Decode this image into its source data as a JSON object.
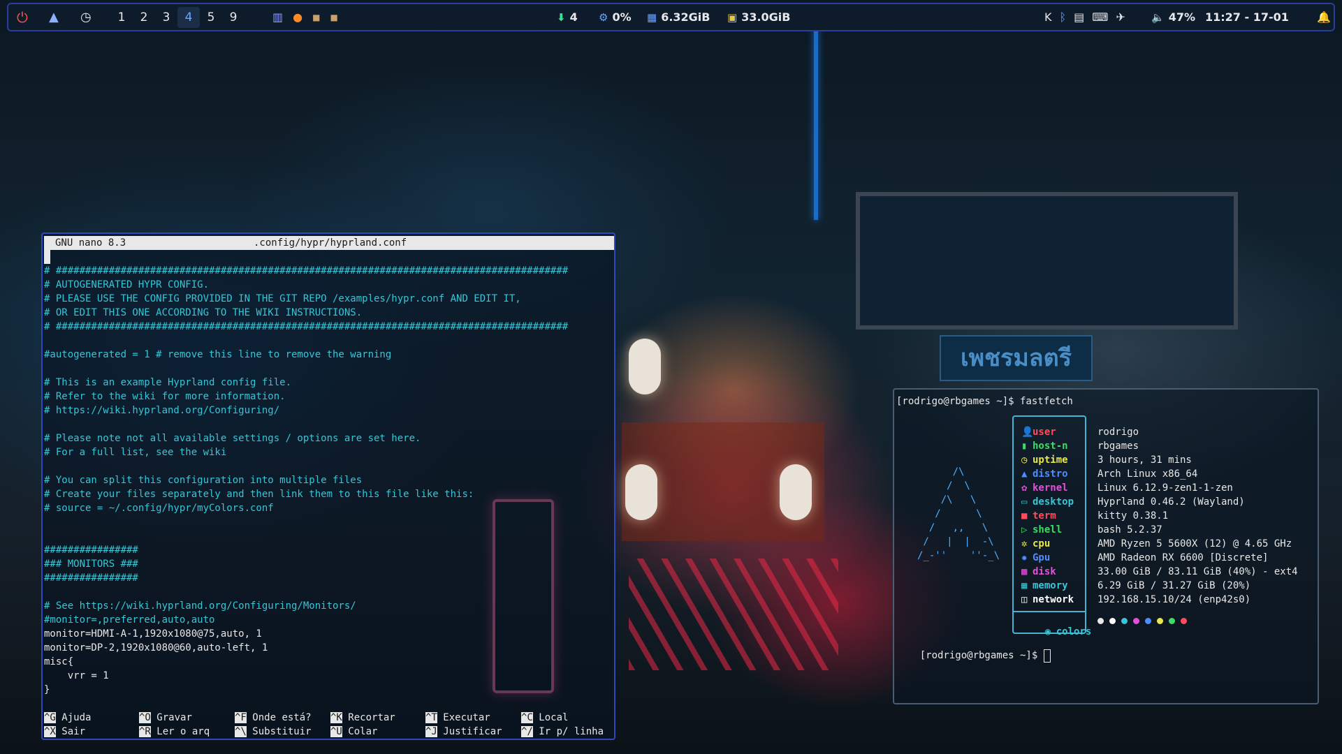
{
  "topbar": {
    "power_icon": "power-icon",
    "launcher_icon": "arch-icon",
    "clock_icon": "clock-icon",
    "workspaces": [
      {
        "label": "1",
        "active": false
      },
      {
        "label": "2",
        "active": false
      },
      {
        "label": "3",
        "active": false
      },
      {
        "label": "4",
        "active": true
      },
      {
        "label": "5",
        "active": false
      },
      {
        "label": "9",
        "active": false
      }
    ],
    "updates": "4",
    "cpu": "0%",
    "memory": "6.32GiB",
    "disk": "33.0GiB",
    "volume": "47%",
    "datetime": "11:27 - 17-01",
    "colors": {
      "bar_bg": "#0e1b2a",
      "border": "#2a3c9e",
      "accent": "#6ea4ff",
      "power": "#ff4d4d"
    }
  },
  "nano": {
    "app": "GNU nano 8.3",
    "file": ".config/hypr/hyprland.conf",
    "lines": [
      {
        "text": "# #######################################################################################",
        "comment": true
      },
      {
        "text": "# AUTOGENERATED HYPR CONFIG.",
        "comment": true
      },
      {
        "text": "# PLEASE USE THE CONFIG PROVIDED IN THE GIT REPO /examples/hypr.conf AND EDIT IT,",
        "comment": true
      },
      {
        "text": "# OR EDIT THIS ONE ACCORDING TO THE WIKI INSTRUCTIONS.",
        "comment": true
      },
      {
        "text": "# #######################################################################################",
        "comment": true
      },
      {
        "text": "",
        "comment": false
      },
      {
        "text": "#autogenerated = 1 # remove this line to remove the warning",
        "comment": true
      },
      {
        "text": "",
        "comment": false
      },
      {
        "text": "# This is an example Hyprland config file.",
        "comment": true
      },
      {
        "text": "# Refer to the wiki for more information.",
        "comment": true
      },
      {
        "text": "# https://wiki.hyprland.org/Configuring/",
        "comment": true
      },
      {
        "text": "",
        "comment": false
      },
      {
        "text": "# Please note not all available settings / options are set here.",
        "comment": true
      },
      {
        "text": "# For a full list, see the wiki",
        "comment": true
      },
      {
        "text": "",
        "comment": false
      },
      {
        "text": "# You can split this configuration into multiple files",
        "comment": true
      },
      {
        "text": "# Create your files separately and then link them to this file like this:",
        "comment": true
      },
      {
        "text": "# source = ~/.config/hypr/myColors.conf",
        "comment": true
      },
      {
        "text": "",
        "comment": false
      },
      {
        "text": "",
        "comment": false
      },
      {
        "text": "################",
        "comment": true
      },
      {
        "text": "### MONITORS ###",
        "comment": true
      },
      {
        "text": "################",
        "comment": true
      },
      {
        "text": "",
        "comment": false
      },
      {
        "text": "# See https://wiki.hyprland.org/Configuring/Monitors/",
        "comment": true
      },
      {
        "text": "#monitor=,preferred,auto,auto",
        "comment": true
      },
      {
        "text": "monitor=HDMI-A-1,1920x1080@75,auto, 1",
        "comment": false
      },
      {
        "text": "monitor=DP-2,1920x1080@60,auto-left, 1",
        "comment": false
      },
      {
        "text": "misc{",
        "comment": false
      },
      {
        "text": "    vrr = 1",
        "comment": false
      },
      {
        "text": "}",
        "comment": false
      }
    ],
    "shortcuts": [
      {
        "key": "^G",
        "label": "Ajuda"
      },
      {
        "key": "^X",
        "label": "Sair"
      },
      {
        "key": "^O",
        "label": "Gravar"
      },
      {
        "key": "^R",
        "label": "Ler o arq"
      },
      {
        "key": "^F",
        "label": "Onde está?"
      },
      {
        "key": "^\\",
        "label": "Substituir"
      },
      {
        "key": "^K",
        "label": "Recortar"
      },
      {
        "key": "^U",
        "label": "Colar"
      },
      {
        "key": "^T",
        "label": "Executar"
      },
      {
        "key": "^J",
        "label": "Justificar"
      },
      {
        "key": "^C",
        "label": "Local"
      },
      {
        "key": "^/",
        "label": "Ir p/ linha"
      }
    ],
    "comment_color": "#36c6d6"
  },
  "terminal": {
    "prompt1": "[rodrigo@rbgames ~]$ fastfetch",
    "prompt2": "[rodrigo@rbgames ~]$ ",
    "logo": [
      "      /\\",
      "     /  \\",
      "    /\\   \\",
      "   /      \\",
      "  /   ,,   \\",
      " /   |  |  -\\",
      "/_-''    ''-_\\"
    ],
    "info": [
      {
        "key": "user",
        "value": "rodrigo",
        "color": "#ff4d5e",
        "icon": "person-icon"
      },
      {
        "key": "host-n",
        "value": "rbgames",
        "color": "#3ddc62",
        "icon": "host-icon"
      },
      {
        "key": "uptime",
        "value": "3 hours, 31 mins",
        "color": "#e8e84a",
        "icon": "clock-icon"
      },
      {
        "key": "distro",
        "value": "Arch Linux x86_64",
        "color": "#4f8cff",
        "icon": "arch-icon"
      },
      {
        "key": "kernel",
        "value": "Linux 6.12.9-zen1-1-zen",
        "color": "#e24fd8",
        "icon": "gear-icon"
      },
      {
        "key": "desktop",
        "value": "Hyprland 0.46.2 (Wayland)",
        "color": "#36c6d6",
        "icon": "monitor-icon"
      },
      {
        "key": "term",
        "value": "kitty 0.38.1",
        "color": "#ff4d5e",
        "icon": "terminal-icon"
      },
      {
        "key": "shell",
        "value": "bash 5.2.37",
        "color": "#3ddc62",
        "icon": "shell-icon"
      },
      {
        "key": "cpu",
        "value": "AMD Ryzen 5 5600X (12) @ 4.65 GHz",
        "color": "#e8e84a",
        "icon": "cpu-icon"
      },
      {
        "key": "Gpu",
        "value": "AMD Radeon RX 6600 [Discrete]",
        "color": "#4f8cff",
        "icon": "gpu-icon"
      },
      {
        "key": "disk",
        "value": "33.00 GiB / 83.11 GiB (40%) - ext4",
        "color": "#e24fd8",
        "icon": "disk-icon"
      },
      {
        "key": "memory",
        "value": "6.29 GiB / 31.27 GiB (20%)",
        "color": "#36c6d6",
        "icon": "memory-icon"
      },
      {
        "key": "network",
        "value": "192.168.15.10/24 (enp42s0)",
        "color": "#ffffff",
        "icon": "network-icon"
      }
    ],
    "colors_label": "colors",
    "palette": [
      "#e8e8e8",
      "#ffffff",
      "#36c6d6",
      "#e24fd8",
      "#4f8cff",
      "#e8e84a",
      "#3ddc62",
      "#ff4d5e"
    ]
  }
}
